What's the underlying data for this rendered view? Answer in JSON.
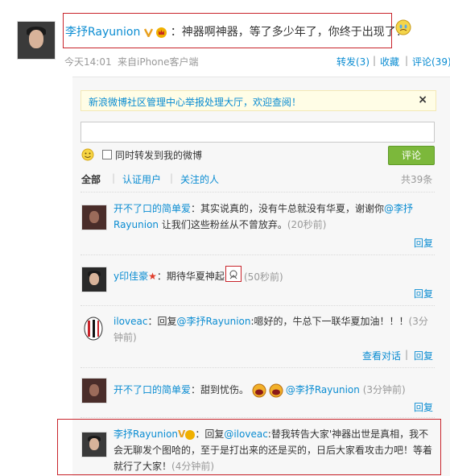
{
  "post": {
    "author": "李抒Rayunion",
    "text": "：神器啊神器，等了多少年了，你终于出现了！",
    "time": "今天14:01",
    "source": "来自iPhone客户端",
    "forward_label": "转发(3)",
    "favorite_label": "收藏",
    "comment_label": "评论(39)"
  },
  "notice": {
    "text": "新浪微博社区管理中心举报处理大厅，欢迎查阅！",
    "close": "×"
  },
  "composer": {
    "placeholder": "",
    "repost_label": "同时转发到我的微博",
    "submit_label": "评论"
  },
  "filters": {
    "all": "全部",
    "verified": "认证用户",
    "following": "关注的人",
    "total": "共39条",
    "separator": "|"
  },
  "comments": [
    {
      "name": "开不了口的简单爱",
      "text_before": "：其实说真的，没有牛总就没有华夏，谢谢你",
      "mention": "@李抒Rayunion",
      "text_after": " 让我们这些粉丝从不曾放弃。",
      "time": "(20秒前)",
      "reply": "回复"
    },
    {
      "name": "y印佳豪",
      "text": "：期待华夏神起",
      "time": "(50秒前)",
      "reply": "回复"
    },
    {
      "name": "iloveac",
      "text_before": "：回复",
      "mention": "@李抒Rayunion",
      "text_after": ":嗯好的，牛总下一联华夏加油！！！",
      "time": "(3分钟前)",
      "view_conversation": "查看对话",
      "separator": "|",
      "reply": "回复"
    },
    {
      "name": "开不了口的简单爱",
      "text": "：甜到忧伤。",
      "mention": "@李抒Rayunion",
      "time": "(3分钟前)",
      "reply": "回复"
    },
    {
      "name": "李抒Rayunion",
      "text_before": "：回复",
      "mention": "@iloveac",
      "text_after": ":替我转告大家'神器出世是真相，我不会无聊发个图哈的，至于是打出来的还是买的，日后大家看攻击力吧！等着就行了大家！",
      "time": "(4分钟前)"
    }
  ],
  "icons": {
    "verified_v": "verified-v-icon",
    "crown": "crown-badge-icon",
    "emoji_face": "smiley-icon",
    "acmilan": "acmilan-logo-icon"
  },
  "colors": {
    "link": "#0a8cd2",
    "highlight_box": "#c8242b",
    "submit_button": "#7cb83b",
    "notice_bg": "#fffde6"
  }
}
